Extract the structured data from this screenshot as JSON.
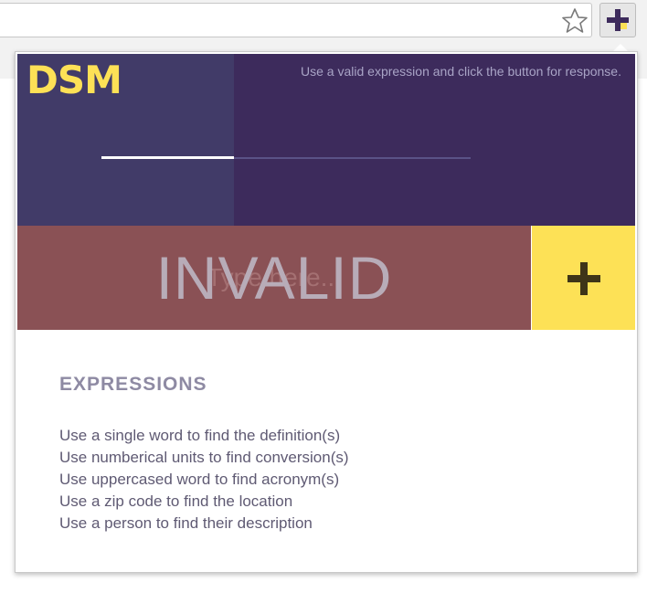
{
  "popup": {
    "logo": "DSM",
    "hint": "Use a valid expression and click the button for response.",
    "progress": 0.36,
    "input": {
      "placeholder": "Type here...",
      "value": ""
    },
    "status": "INVALID",
    "submit_icon": "plus-icon"
  },
  "expressions": {
    "title": "EXPRESSIONS",
    "items": [
      "Use a single word to find the definition(s)",
      "Use numberical units to find conversion(s)",
      "Use uppercased word to find acronym(s)",
      "Use a zip code to find the location",
      "Use a person to find their description"
    ]
  },
  "colors": {
    "accent": "#fde156",
    "hero": "#3d2b5c",
    "invalid": "#8a5155"
  }
}
